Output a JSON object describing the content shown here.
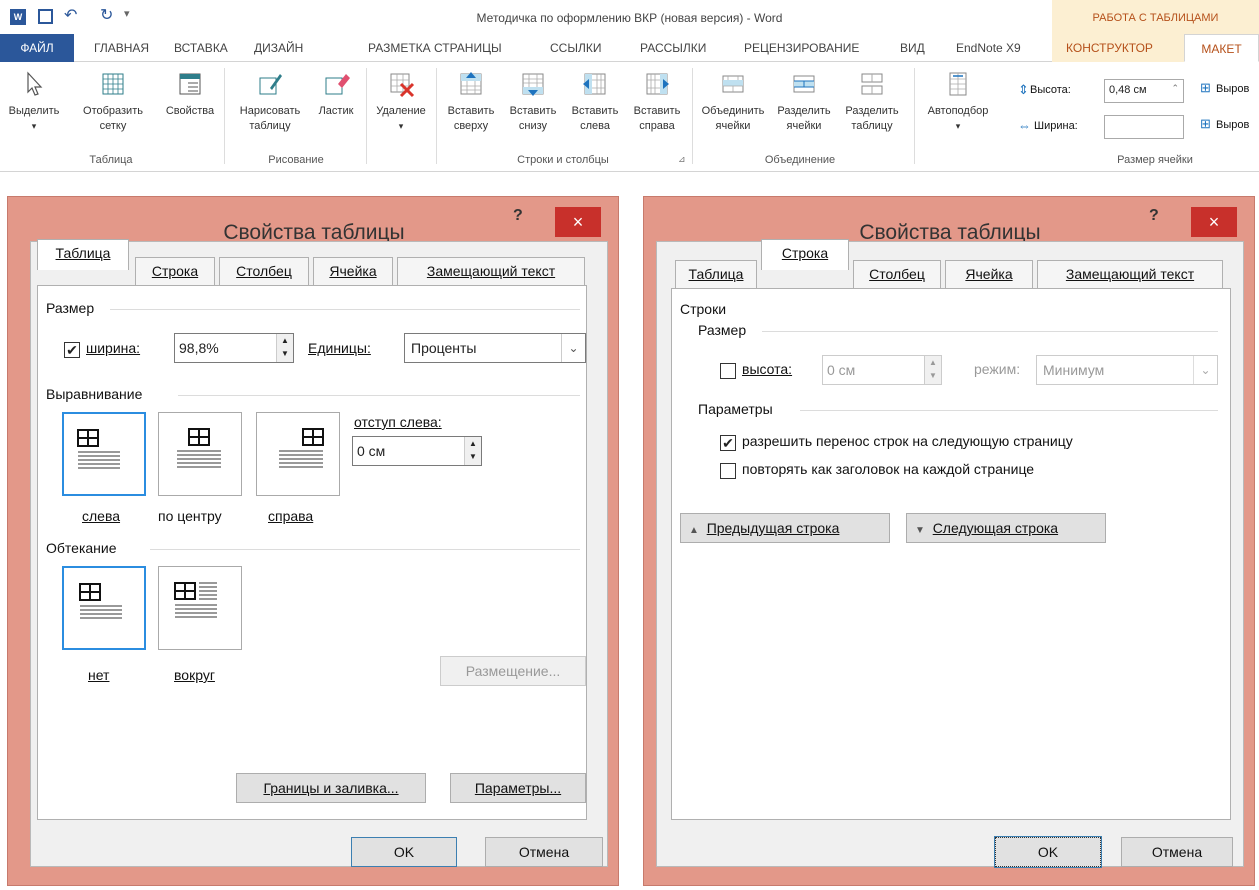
{
  "window": {
    "title": "Методичка по оформлению ВКР (новая версия) - Word",
    "context_group": "РАБОТА С ТАБЛИЦАМИ"
  },
  "menu": {
    "tabs": [
      "ФАЙЛ",
      "ГЛАВНАЯ",
      "ВСТАВКА",
      "ДИЗАЙН",
      "РАЗМЕТКА СТРАНИЦЫ",
      "ССЫЛКИ",
      "РАССЫЛКИ",
      "РЕЦЕНЗИРОВАНИЕ",
      "ВИД",
      "EndNote X9",
      "КОНСТРУКТОР",
      "МАКЕТ"
    ]
  },
  "ribbon": {
    "select": "Выделить",
    "show_grid_1": "Отобразить",
    "show_grid_2": "сетку",
    "properties": "Свойства",
    "group_table": "Таблица",
    "draw_table_1": "Нарисовать",
    "draw_table_2": "таблицу",
    "eraser": "Ластик",
    "group_draw": "Рисование",
    "delete": "Удаление",
    "insert_above_1": "Вставить",
    "insert_above_2": "сверху",
    "insert_below_1": "Вставить",
    "insert_below_2": "снизу",
    "insert_left_1": "Вставить",
    "insert_left_2": "слева",
    "insert_right_1": "Вставить",
    "insert_right_2": "справа",
    "group_rows": "Строки и столбцы",
    "merge_1": "Объединить",
    "merge_2": "ячейки",
    "split_cells_1": "Разделить",
    "split_cells_2": "ячейки",
    "split_table_1": "Разделить",
    "split_table_2": "таблицу",
    "group_merge": "Объединение",
    "autofit": "Автоподбор",
    "height_label": "Высота:",
    "height_value": "0,48 см",
    "width_label": "Ширина:",
    "width_value": "",
    "align_1": "Выров",
    "align_2": "Выров",
    "group_cellsize": "Размер ячейки"
  },
  "dialog_left": {
    "title": "Свойства таблицы",
    "help": "?",
    "close": "×",
    "tabs": [
      "Таблица",
      "Строка",
      "Столбец",
      "Ячейка",
      "Замещающий текст"
    ],
    "size_section": "Размер",
    "width_checkbox_label": "ширина:",
    "width_checked": true,
    "width_value": "98,8%",
    "units_label": "Единицы:",
    "units_value": "Проценты",
    "align_section": "Выравнивание",
    "align_left": "слева",
    "align_center": "по центру",
    "align_right": "справа",
    "indent_label": "отступ слева:",
    "indent_value": "0 см",
    "wrap_section": "Обтекание",
    "wrap_none": "нет",
    "wrap_around": "вокруг",
    "placement_button": "Размещение...",
    "borders_button": "Границы и заливка...",
    "options_button": "Параметры...",
    "ok": "OK",
    "cancel": "Отмена"
  },
  "dialog_right": {
    "title": "Свойства таблицы",
    "help": "?",
    "close": "×",
    "tabs": [
      "Таблица",
      "Строка",
      "Столбец",
      "Ячейка",
      "Замещающий текст"
    ],
    "rows_section": "Строки",
    "size_section": "Размер",
    "height_label": "высота:",
    "height_checked": false,
    "height_value": "0 см",
    "mode_label": "режим:",
    "mode_value": "Минимум",
    "params_section": "Параметры",
    "allow_break_label": "разрешить перенос строк на следующую страницу",
    "allow_break_checked": true,
    "repeat_header_label": "повторять как заголовок на каждой странице",
    "repeat_header_checked": false,
    "prev_row_button": "Предыдущая строка",
    "next_row_button": "Следующая строка",
    "ok": "OK",
    "cancel": "Отмена"
  }
}
